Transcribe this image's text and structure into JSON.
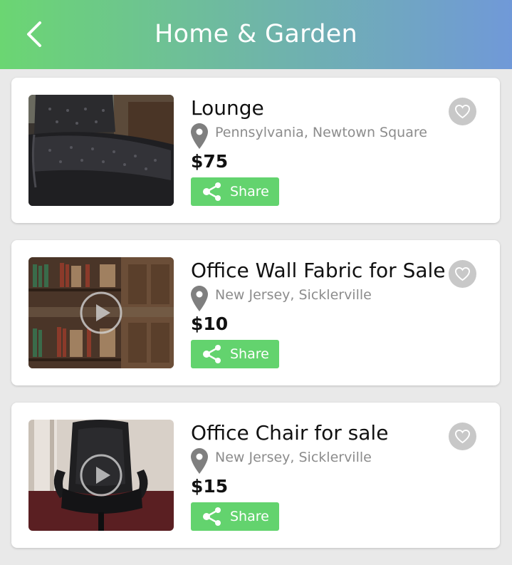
{
  "header": {
    "title": "Home & Garden",
    "back_icon": "chevron-left-icon"
  },
  "colors": {
    "header_gradient_start": "#6bd672",
    "header_gradient_end": "#7099d8",
    "share_button": "#63d36e",
    "favorite_bg": "#c8c8c8",
    "location_text": "#8c8c8c"
  },
  "listings": [
    {
      "title": "Lounge",
      "location": "Pennsylvania, Newtown Square",
      "price": "$75",
      "share_label": "Share",
      "has_video": false,
      "thumbnail": "black leather tufted chaise lounge"
    },
    {
      "title": "Office Wall Fabric for Sale",
      "location": "New Jersey, Sicklerville",
      "price": "$10",
      "share_label": "Share",
      "has_video": true,
      "thumbnail": "wood bookshelf wall"
    },
    {
      "title": "Office Chair for sale",
      "location": "New Jersey, Sicklerville",
      "price": "$15",
      "share_label": "Share",
      "has_video": true,
      "thumbnail": "black leather office chair"
    }
  ]
}
